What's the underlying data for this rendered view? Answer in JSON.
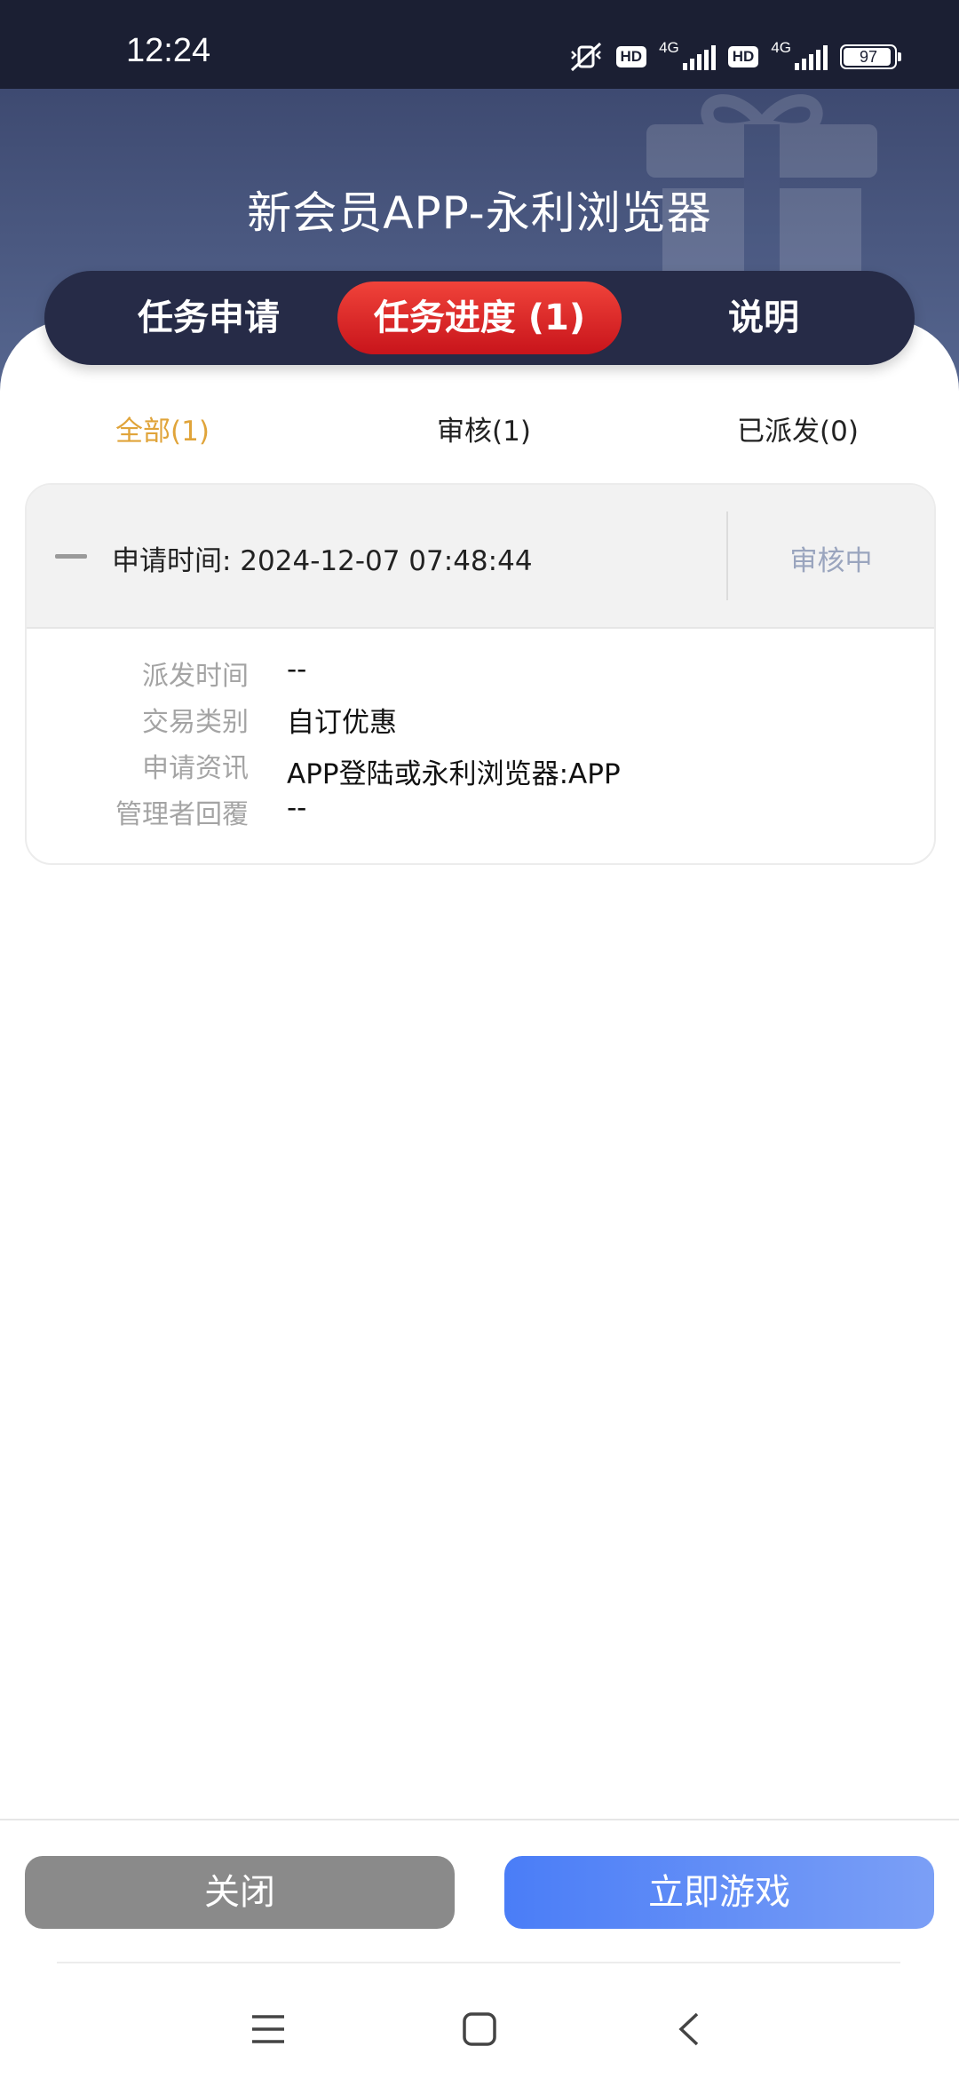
{
  "status_bar": {
    "time": "12:24",
    "hd1": "HD",
    "net1": "4G",
    "hd2": "HD",
    "net2": "4G",
    "battery": "97"
  },
  "header": {
    "title": "新会员APP-永利浏览器"
  },
  "tabs": {
    "apply": "任务申请",
    "progress": "任务进度 (1)",
    "info": "说明"
  },
  "subtabs": {
    "all": "全部(1)",
    "review": "审核(1)",
    "dispatched": "已派发(0)"
  },
  "record": {
    "apply_time": "申请时间: 2024-12-07 07:48:44",
    "status": "审核中",
    "rows": [
      {
        "label": "派发时间",
        "value": "--"
      },
      {
        "label": "交易类别",
        "value": "自订优惠"
      },
      {
        "label": "申请资讯",
        "value": "APP登陆或永利浏览器:APP"
      },
      {
        "label": "管理者回覆",
        "value": "--"
      }
    ]
  },
  "buttons": {
    "close": "关闭",
    "play": "立即游戏"
  },
  "colors": {
    "accent_red": "#e02d2a",
    "accent_blue": "#4a7df7",
    "subtab_active": "#e0a43a"
  }
}
